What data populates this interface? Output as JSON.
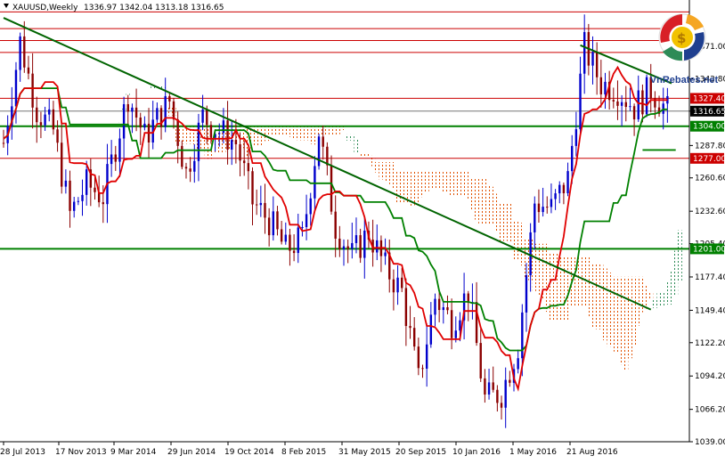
{
  "header": {
    "symbol": "XAUUSD,Weekly",
    "ohlc": "1336.97 1342.04 1313.18 1316.65"
  },
  "logo": {
    "text": "VnRebates.net"
  },
  "colors": {
    "bull_candle": "#0000cc",
    "bear_candle": "#8b0000",
    "tenkan": "#e00000",
    "kijun": "#008000",
    "trendline": "#006400",
    "cloud_bear": "#e05000",
    "cloud_bull": "#2e8b57",
    "res_line": "#cc0000",
    "sup_line": "#008000",
    "price_line": "#777777"
  },
  "chart_data": {
    "type": "candlestick",
    "title": "",
    "ylim": [
      1039.0,
      1410.0
    ],
    "y_ticks": [
      1371.0,
      1343.8,
      1316.65,
      1287.8,
      1260.6,
      1232.6,
      1205.4,
      1177.4,
      1149.4,
      1122.2,
      1094.2,
      1066.2,
      1039.0
    ],
    "y_tick_labels": [
      "1371.00",
      "1343.80",
      "1316.65",
      "1287.80",
      "1260.60",
      "1232.60",
      "1205.40",
      "1177.40",
      "1149.40",
      "1122.20",
      "1094.20",
      "1066.20",
      "1039.00"
    ],
    "x_tick_labels": [
      "28 Jul 2013",
      "17 Nov 2013",
      "9 Mar 2014",
      "29 Jun 2014",
      "19 Oct 2014",
      "8 Feb 2015",
      "31 May 2015",
      "20 Sep 2015",
      "10 Jan 2016",
      "1 May 2016",
      "21 Aug 2016"
    ],
    "current_price": 1316.65,
    "current_price_label": "1316.65",
    "horizontal_levels": [
      {
        "value": 1327.4,
        "label": "1327.40",
        "kind": "resistance"
      },
      {
        "value": 1304.0,
        "label": "1304.00",
        "kind": "support_green"
      },
      {
        "value": 1277.0,
        "label": "1277.00",
        "kind": "resistance"
      },
      {
        "value": 1201.0,
        "label": "1201.00",
        "kind": "support_green"
      },
      {
        "value": 1400.0,
        "label": "",
        "kind": "resistance"
      },
      {
        "value": 1386.0,
        "label": "",
        "kind": "resistance"
      },
      {
        "value": 1376.0,
        "label": "",
        "kind": "resistance"
      },
      {
        "value": 1366.0,
        "label": "",
        "kind": "resistance"
      }
    ],
    "trendlines": [
      {
        "from": [
          "28 Jul 2013",
          1395
        ],
        "to": [
          "21 Aug 2016",
          1150
        ],
        "kind": "long_downtrend",
        "x_from_week": 0,
        "x_to_week": 156
      },
      {
        "from": [
          "1 May 2016",
          1372
        ],
        "to": [
          "21 Aug 2016",
          1340
        ],
        "kind": "short_downtrend",
        "x_from_week": 139,
        "x_to_week": 161
      }
    ],
    "kijun_level_segment": {
      "value": 1284.0,
      "x_from_week": 154,
      "x_to_week": 162
    },
    "weeks_total": 164,
    "series_notes": "Weekly XAUUSD candles with Ichimoku Tenkan (red), Kijun (green) and cloud."
  }
}
